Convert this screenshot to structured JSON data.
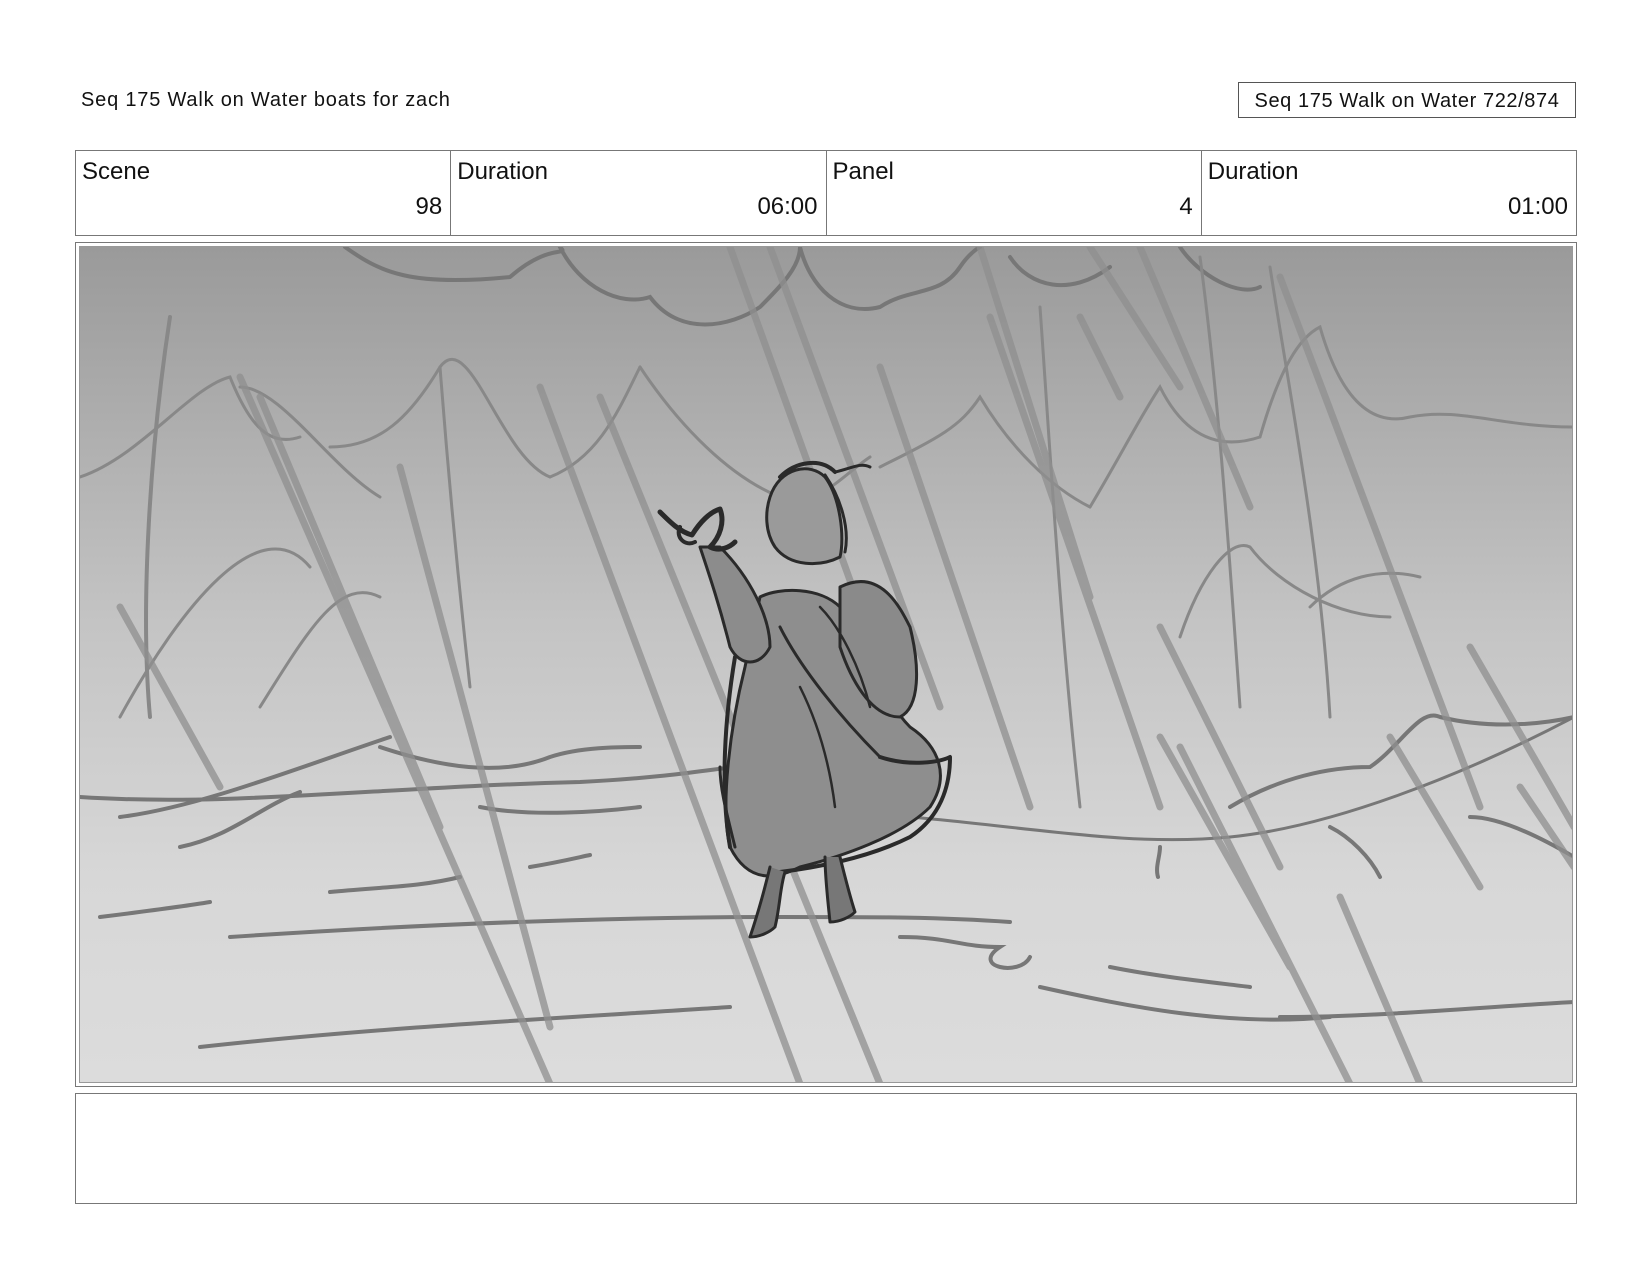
{
  "header": {
    "sequence_title": "Seq 175 Walk on Water  boats for zach",
    "page_counter": "Seq 175 Walk on Water 722/874"
  },
  "info": [
    {
      "label": "Scene",
      "value": "98"
    },
    {
      "label": "Duration",
      "value": "06:00"
    },
    {
      "label": "Panel",
      "value": "4"
    },
    {
      "label": "Duration",
      "value": "01:00"
    }
  ],
  "panel": {
    "content": "grayscale storyboard sketch of a cloaked figure raising a hand in heavy rain"
  },
  "notes": {
    "text": ""
  }
}
